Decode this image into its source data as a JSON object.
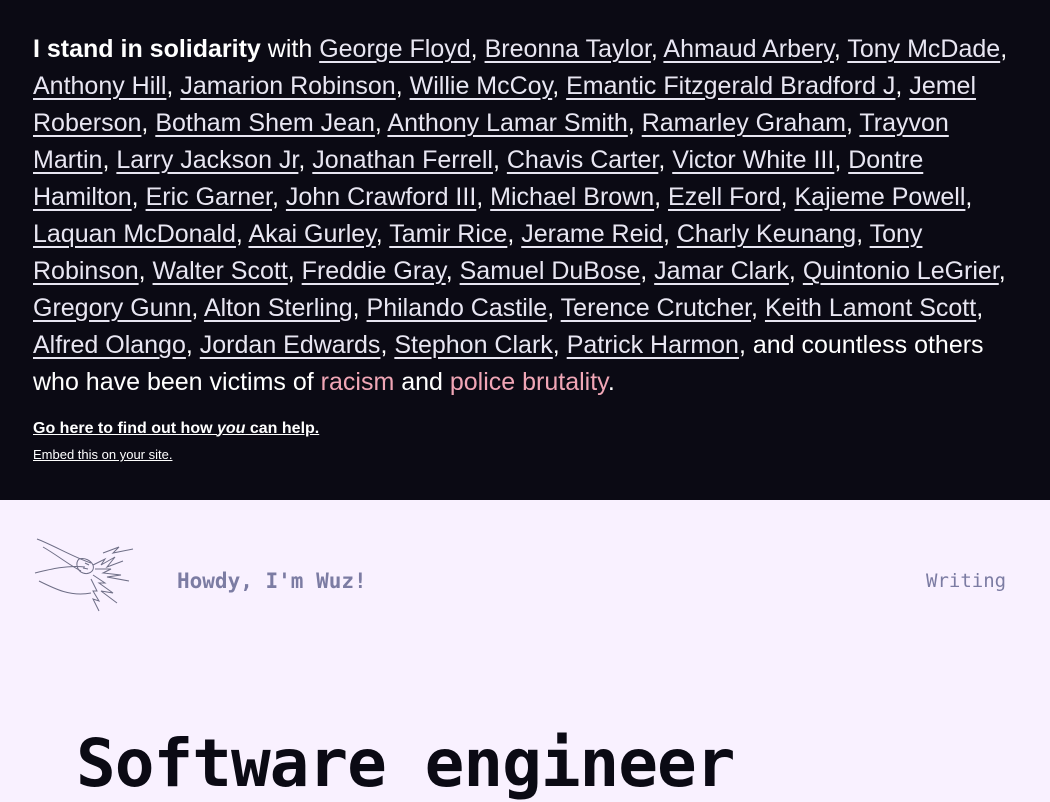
{
  "banner": {
    "lead": "I stand in solidarity",
    "with": " with ",
    "names": [
      "George Floyd",
      "Breonna Taylor",
      "Ahmaud Arbery",
      "Tony McDade",
      "Anthony Hill",
      "Jamarion Robinson",
      "Willie McCoy",
      "Emantic Fitzgerald Bradford J",
      "Jemel Roberson",
      "Botham Shem Jean",
      "Anthony Lamar Smith",
      "Ramarley Graham",
      "Trayvon Martin",
      "Larry Jackson Jr",
      "Jonathan Ferrell",
      "Chavis Carter",
      "Victor White III",
      "Dontre Hamilton",
      "Eric Garner",
      "John Crawford III",
      "Michael Brown",
      "Ezell Ford",
      "Kajieme Powell",
      "Laquan McDonald",
      "Akai Gurley",
      "Tamir Rice",
      "Jerame Reid",
      "Charly Keunang",
      "Tony Robinson",
      "Walter Scott",
      "Freddie Gray",
      "Samuel DuBose",
      "Jamar Clark",
      "Quintonio LeGrier",
      "Gregory Gunn",
      "Alton Sterling",
      "Philando Castile",
      "Terence Crutcher",
      "Keith Lamont Scott",
      "Alfred Olango",
      "Jordan Edwards",
      "Stephon Clark",
      "Patrick Harmon"
    ],
    "tail": ", and countless others who have been victims of ",
    "racism": "racism",
    "and": " and ",
    "police_brutality": "police brutality",
    "period": ".",
    "help_prefix": "Go here to find out how ",
    "help_you": "you",
    "help_suffix": " can help.",
    "embed": "Embed this on your site."
  },
  "header": {
    "title": "Howdy, I'm Wuz!",
    "nav": [
      "Writing"
    ]
  },
  "hero": {
    "title": "Software engineer"
  },
  "colors": {
    "banner_bg": "#0b0a14",
    "page_bg": "#f9f1ff",
    "accent_pink": "#f0a6b6",
    "muted_purple": "#7c7ca3"
  }
}
